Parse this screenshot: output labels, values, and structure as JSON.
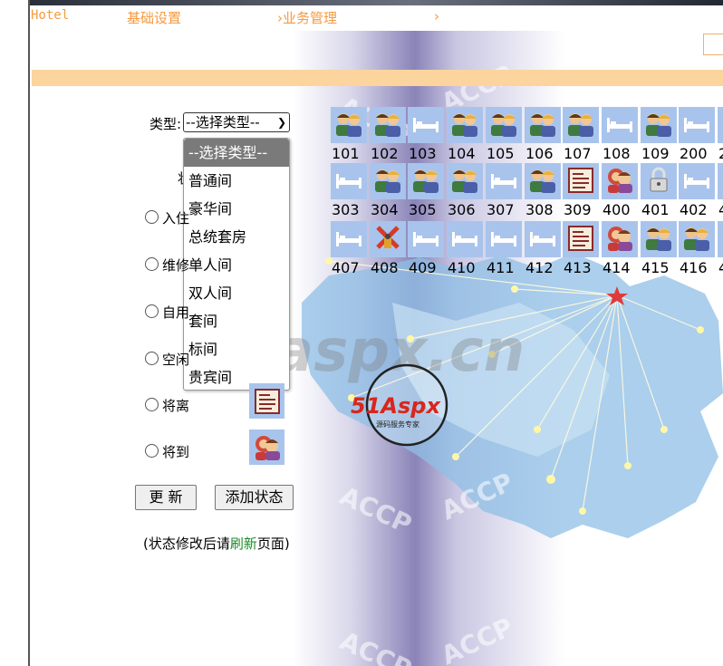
{
  "nav": {
    "hotel": "Hotel",
    "basic": "基础设置",
    "business": "›业务管理",
    "more": "›"
  },
  "filter": {
    "type_label": "类型:",
    "type_selected": "--选择类型--",
    "type_options": [
      "--选择类型--",
      "普通间",
      "豪华间",
      "总统套房",
      "单人间",
      "双人间",
      "套间",
      "标间",
      "贵宾间"
    ],
    "status_label_partial": "状"
  },
  "legend": [
    {
      "label": "入住",
      "icon": "guests-icon"
    },
    {
      "label": "维修",
      "icon": "repair-icon"
    },
    {
      "label": "自用",
      "icon": "lock-icon"
    },
    {
      "label": "空闲",
      "icon": "empty-bed-icon"
    },
    {
      "label": "将离",
      "icon": "checkout-doc-icon"
    },
    {
      "label": "将到",
      "icon": "arriving-icon"
    }
  ],
  "buttons": {
    "update": "更 新",
    "add_status": "添加状态"
  },
  "note": {
    "prefix": "(状态修改后请",
    "link": "刷新",
    "suffix": "页面)"
  },
  "watermark": {
    "logo": "51Aspx",
    "tagline": "源码服务专家",
    "big": "aspx.cn",
    "accp": "ACCP"
  },
  "rooms": [
    [
      {
        "num": "101",
        "icon": "guests-icon"
      },
      {
        "num": "102",
        "icon": "guests-icon"
      },
      {
        "num": "103",
        "icon": "empty-bed-icon"
      },
      {
        "num": "104",
        "icon": "guests-icon"
      },
      {
        "num": "105",
        "icon": "guests-icon"
      },
      {
        "num": "106",
        "icon": "guests-icon"
      },
      {
        "num": "107",
        "icon": "guests-icon"
      },
      {
        "num": "108",
        "icon": "empty-bed-icon"
      },
      {
        "num": "109",
        "icon": "guests-icon"
      },
      {
        "num": "200",
        "icon": "empty-bed-icon"
      },
      {
        "num": "2",
        "icon": "empty-bed-icon"
      }
    ],
    [
      {
        "num": "303",
        "icon": "empty-bed-icon"
      },
      {
        "num": "304",
        "icon": "guests-icon"
      },
      {
        "num": "305",
        "icon": "guests-icon"
      },
      {
        "num": "306",
        "icon": "guests-icon"
      },
      {
        "num": "307",
        "icon": "empty-bed-icon"
      },
      {
        "num": "308",
        "icon": "guests-icon"
      },
      {
        "num": "309",
        "icon": "checkout-doc-icon"
      },
      {
        "num": "400",
        "icon": "arriving-icon"
      },
      {
        "num": "401",
        "icon": "lock-icon"
      },
      {
        "num": "402",
        "icon": "empty-bed-icon"
      },
      {
        "num": "4",
        "icon": "empty-bed-icon"
      }
    ],
    [
      {
        "num": "407",
        "icon": "empty-bed-icon"
      },
      {
        "num": "408",
        "icon": "repair-icon"
      },
      {
        "num": "409",
        "icon": "empty-bed-icon"
      },
      {
        "num": "410",
        "icon": "empty-bed-icon"
      },
      {
        "num": "411",
        "icon": "empty-bed-icon"
      },
      {
        "num": "412",
        "icon": "empty-bed-icon"
      },
      {
        "num": "413",
        "icon": "checkout-doc-icon"
      },
      {
        "num": "414",
        "icon": "arriving-icon"
      },
      {
        "num": "415",
        "icon": "guests-icon"
      },
      {
        "num": "416",
        "icon": "guests-icon"
      },
      {
        "num": "4",
        "icon": "empty-bed-icon"
      }
    ]
  ],
  "colors": {
    "nav_text": "#f59a3f",
    "orange_bar": "#fbd49e",
    "tile": "#a9c4ec",
    "link": "#1d8a2a"
  }
}
